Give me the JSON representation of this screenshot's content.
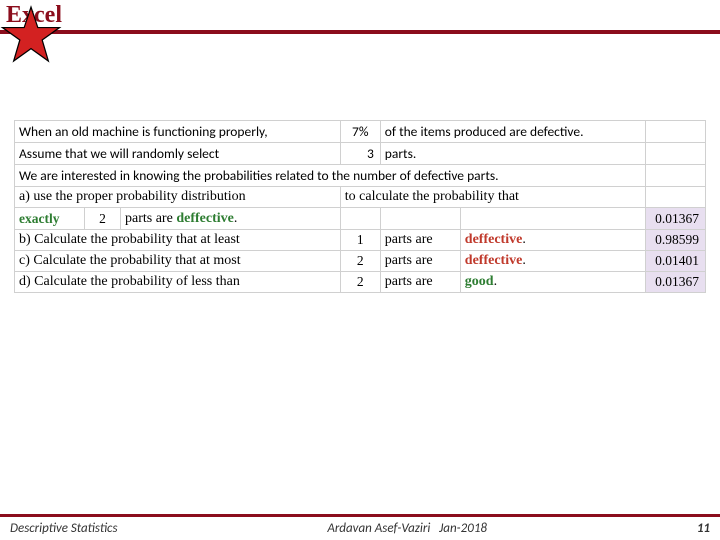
{
  "header": {
    "title": "Excel"
  },
  "rows": {
    "r1a": "When an old machine is functioning properly,",
    "r1pct": "7%",
    "r1b": "of the items produced are defective.",
    "r2a": "Assume that we will randomly select",
    "r2n": "3",
    "r2b": "parts.",
    "r3": "We are interested in knowing the probabilities related to the number of defective parts.",
    "r4a": "a) use the proper probability distribution",
    "r4b": "to calculate the probability that",
    "r5_word": "exactly",
    "r5_n": "2",
    "r5_mid": "parts are",
    "r5_def": "deffective",
    "r5_res": "0.01367",
    "r6a": "b) Calculate the probability that at least",
    "r6_n": "1",
    "r6_mid": "parts are",
    "r6_def": "deffective",
    "r6_res": "0.98599",
    "r7a": "c) Calculate the probability that at most",
    "r7_n": "2",
    "r7_mid": "parts are",
    "r7_def": "deffective",
    "r7_res": "0.01401",
    "r8a": "d) Calculate the probability of less than",
    "r8_n": "2",
    "r8_mid": "parts are",
    "r8_good": "good",
    "r8_res": "0.01367"
  },
  "footer": {
    "left": "Descriptive Statistics",
    "center_author": "Ardavan Asef-Vaziri",
    "center_date": "Jan-2018",
    "page": "11"
  }
}
